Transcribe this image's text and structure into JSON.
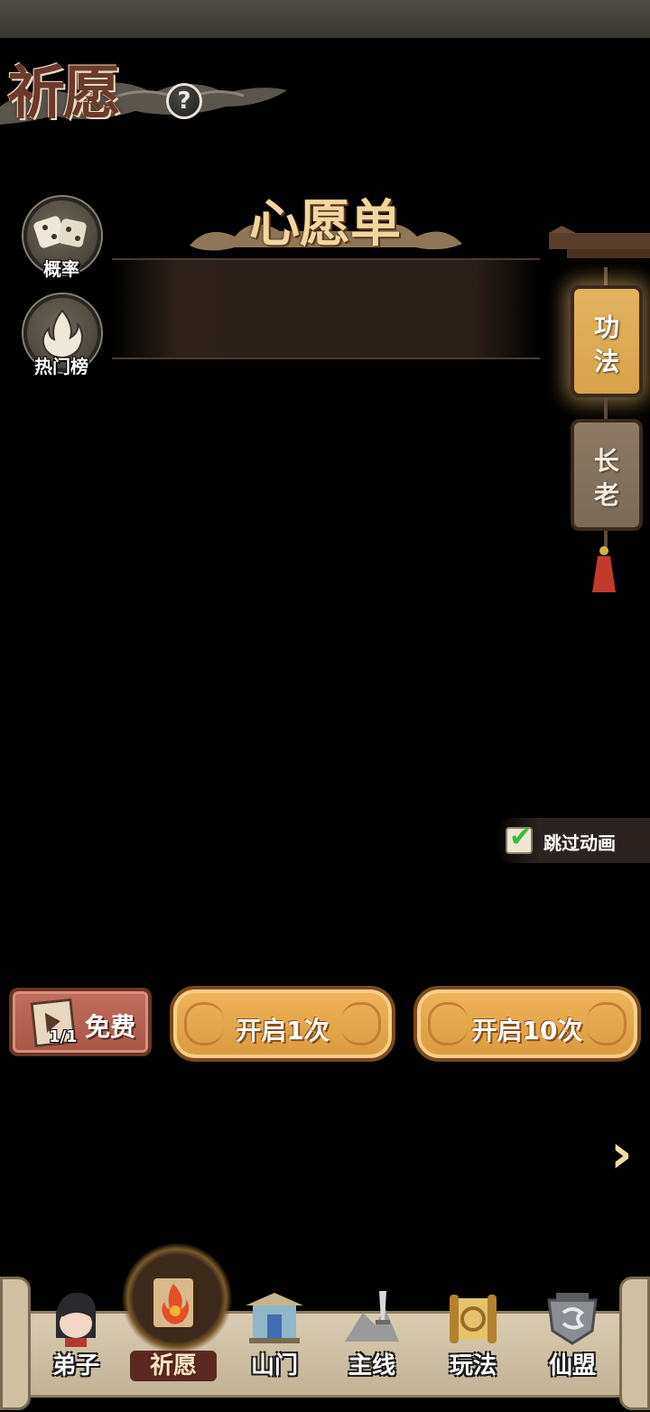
{
  "header": {
    "title": "祈愿",
    "help_icon_label": "?"
  },
  "side_buttons": [
    {
      "label": "概率",
      "icon": "dice-icon"
    },
    {
      "label": "热门榜",
      "icon": "ranking-flame-icon"
    }
  ],
  "wish_list": {
    "title": "心愿单"
  },
  "lantern_tabs": [
    {
      "label": "功\n法",
      "active": true
    },
    {
      "label": "长\n老",
      "active": false
    }
  ],
  "skip_animation": {
    "label": "跳过动画",
    "checked": true
  },
  "actions": {
    "free": {
      "count": "1/1",
      "label": "免费"
    },
    "open_once": "开启1次",
    "open_ten": "开启10次"
  },
  "bottom_nav": {
    "items": [
      {
        "label": "弟子",
        "icon": "disciple-avatar-icon",
        "active": false
      },
      {
        "label": "祈愿",
        "icon": "wish-scroll-flame-icon",
        "active": true
      },
      {
        "label": "山门",
        "icon": "sect-gate-icon",
        "active": false
      },
      {
        "label": "主线",
        "icon": "main-quest-sword-icon",
        "active": false
      },
      {
        "label": "玩法",
        "icon": "gameplay-scroll-icon",
        "active": false
      },
      {
        "label": "仙盟",
        "icon": "alliance-emblem-icon",
        "active": false
      }
    ]
  },
  "colors": {
    "accent_gold": "#e3b35f",
    "free_button": "#c26e5c",
    "skip_check": "#2fbf3a"
  }
}
